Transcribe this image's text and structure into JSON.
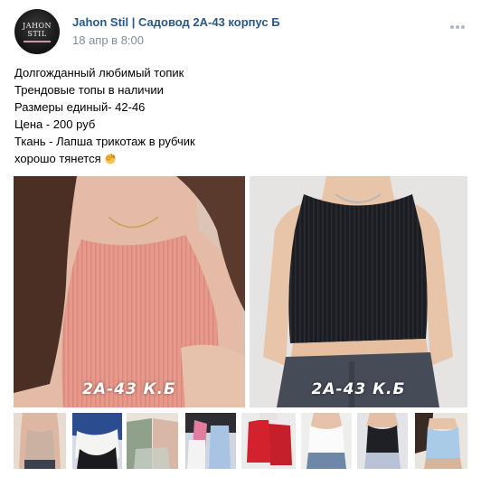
{
  "post": {
    "author": "Jahon Stil | Садовод 2А-43 корпус Б",
    "date": "18 апр в 8:00",
    "avatar": {
      "line1": "JAHON",
      "line2": "STIL"
    },
    "text_lines": [
      "Долгожданный любимый топик",
      "Трендовые топы в наличии",
      "Размеры единый- 42-46",
      "Цена - 200 руб",
      "Ткань - Лапша трикотаж в рубчик",
      "хорошо тянется"
    ],
    "emoji": "ok-hand-icon"
  },
  "photos": [
    {
      "name": "pink-ribbed-top-photo",
      "watermark": "2А-43 К.Б"
    },
    {
      "name": "black-ribbed-top-photo",
      "watermark": "2А-43 К.Б"
    }
  ],
  "thumbnails": [
    {
      "name": "thumbnail-1"
    },
    {
      "name": "thumbnail-2"
    },
    {
      "name": "thumbnail-3"
    },
    {
      "name": "thumbnail-4"
    },
    {
      "name": "thumbnail-5"
    },
    {
      "name": "thumbnail-6"
    },
    {
      "name": "thumbnail-7"
    },
    {
      "name": "thumbnail-8"
    }
  ],
  "colors": {
    "link": "#2a5885",
    "meta": "#818c99",
    "pink_top": "#e79a8c",
    "black_top": "#1c1d22"
  }
}
